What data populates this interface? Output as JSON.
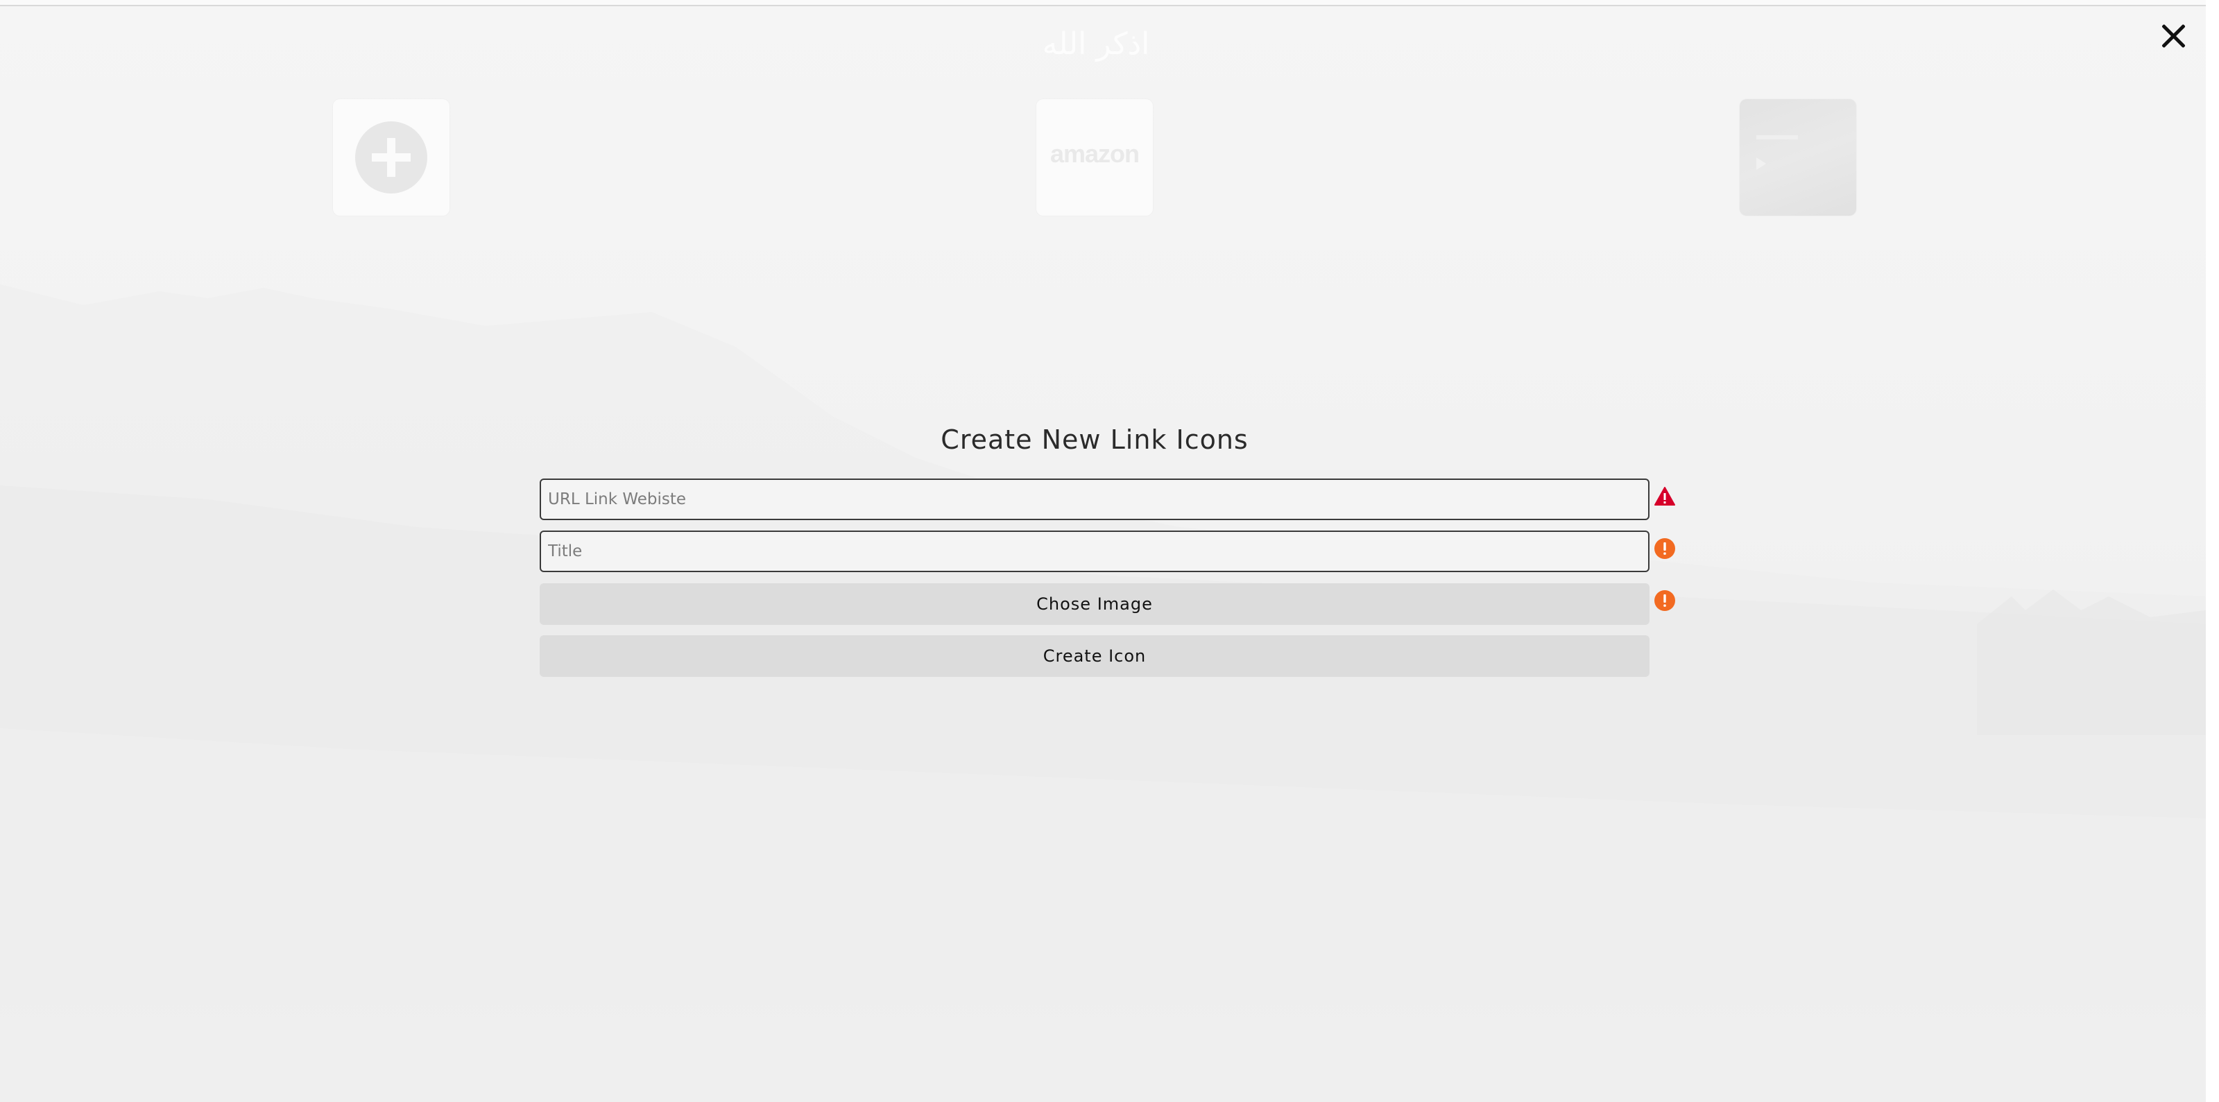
{
  "background": {
    "header_text": "اذكر الله",
    "tiles": [
      {
        "name": "add-link-tile",
        "icon": "plus-circle-icon"
      },
      {
        "name": "amazon-tile",
        "text": "amazon"
      },
      {
        "name": "media-tile",
        "icon": "play-icon"
      }
    ]
  },
  "modal": {
    "title": "Create New Link Icons",
    "url_placeholder": "URL Link Webiste",
    "title_placeholder": "Title",
    "choose_image_label": "Chose Image",
    "create_icon_label": "Create Icon",
    "close_icon": "close-icon",
    "status_icons": [
      {
        "field": "url",
        "icon": "warning-triangle-icon",
        "color": "#d6002a"
      },
      {
        "field": "title",
        "icon": "exclamation-circle-icon",
        "color": "#f26a21"
      },
      {
        "field": "image",
        "icon": "exclamation-circle-icon",
        "color": "#f26a21"
      }
    ]
  }
}
